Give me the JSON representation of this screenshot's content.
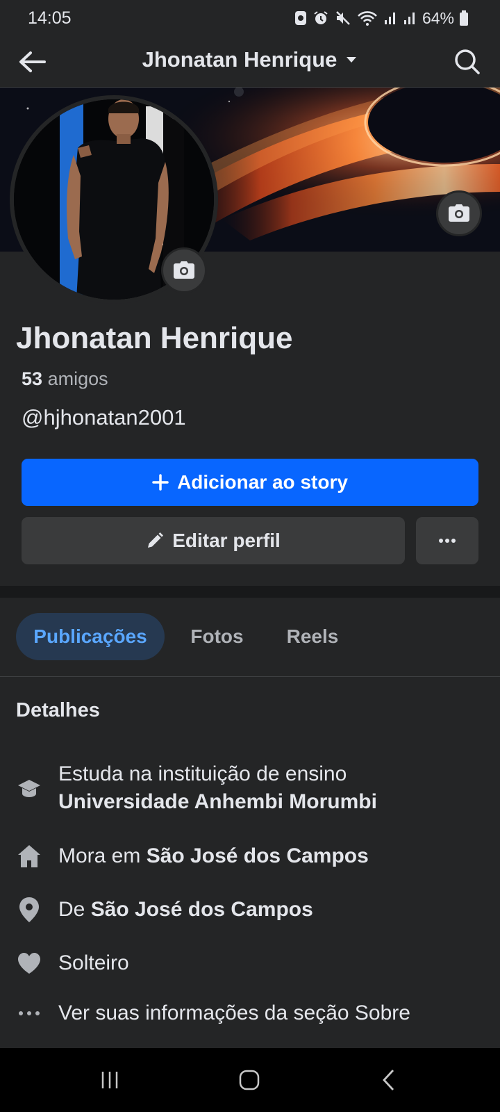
{
  "status_bar": {
    "time": "14:05",
    "battery": "64%",
    "icons": [
      "notification-icon",
      "alarm-icon",
      "mute-icon",
      "wifi-icon",
      "signal-icon",
      "signal-icon",
      "battery-icon"
    ]
  },
  "header": {
    "title": "Jhonatan Henrique",
    "back_icon": "arrow-left-icon",
    "dropdown_icon": "caret-down-icon",
    "search_icon": "search-icon"
  },
  "profile": {
    "name": "Jhonatan Henrique",
    "friends_count": "53",
    "friends_label": "amigos",
    "username": "@hjhonatan2001"
  },
  "actions": {
    "add_story": "Adicionar ao story",
    "edit_profile": "Editar perfil"
  },
  "tabs": [
    {
      "label": "Publicações",
      "active": true
    },
    {
      "label": "Fotos",
      "active": false
    },
    {
      "label": "Reels",
      "active": false
    }
  ],
  "details": {
    "title": "Detalhes",
    "items": [
      {
        "icon": "graduation-cap-icon",
        "prefix": "Estuda na instituição de ensino",
        "bold": "Universidade Anhembi Morumbi"
      },
      {
        "icon": "home-icon",
        "prefix": "Mora em ",
        "bold": "São José dos Campos"
      },
      {
        "icon": "location-pin-icon",
        "prefix": "De ",
        "bold": "São José dos Campos"
      },
      {
        "icon": "heart-icon",
        "prefix": "Solteiro",
        "bold": ""
      },
      {
        "icon": "more-dots-icon",
        "prefix": "Ver suas informações da seção Sobre",
        "bold": ""
      }
    ]
  },
  "colors": {
    "background": "#242526",
    "accent": "#0866ff",
    "secondary_button": "#3a3b3c",
    "active_tab_bg": "#263951",
    "active_tab_text": "#5aa7ff"
  }
}
